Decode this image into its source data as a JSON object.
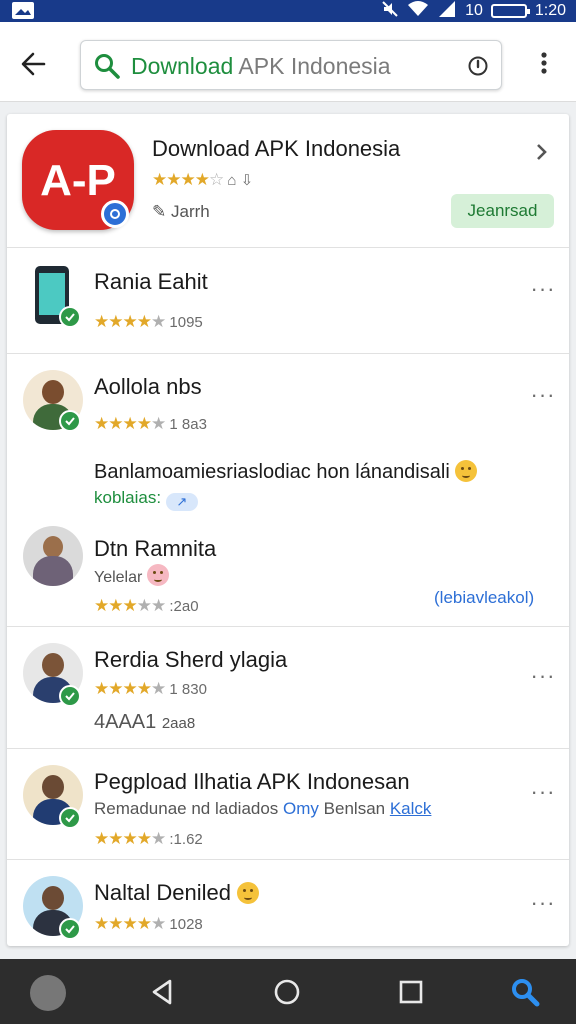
{
  "status_bar": {
    "time": "1:20",
    "battery_text": "10"
  },
  "search": {
    "typed": "Download",
    "ghost": " APK Indonesia"
  },
  "top_app": {
    "title": "Download APK Indonesia",
    "logo_text": "A-P",
    "developer": "Jarrh",
    "install_label": "Jeanrsad",
    "rating": 3.5
  },
  "items": [
    {
      "title": "Rania Eahit",
      "rating_count": "1095",
      "rating": 3.5
    },
    {
      "title": "Aollola nbs",
      "rating_count": "1 8a3",
      "rating": 4.5
    },
    {
      "title": "Banlamoamiesriaslodiac hon lánandisali",
      "link": "koblaias:",
      "pill": "↗"
    },
    {
      "title": "Dtn Ramnita",
      "subtitle": "Yelelar",
      "rating_count": ":2a0",
      "rating": 3.5,
      "action": "(lebiavleakol)"
    },
    {
      "title": "Rerdia Sherd ylagia",
      "rating_count": "1 830",
      "rating": 4.5,
      "extra": "4AAA1",
      "extra_count": "2aa8"
    },
    {
      "title": "Pegpload Ilhatia APK Indonesan",
      "subtitle": "Remadunae nd ladiados",
      "subtitle_blue": "Omy",
      "subtitle_rest": "Benlsan",
      "subtitle_link": "Kalck",
      "rating_count": ":1.62",
      "rating": 4.5
    },
    {
      "title": "Naltal Deniled",
      "rating_count": "1028",
      "rating": 4.5
    }
  ]
}
